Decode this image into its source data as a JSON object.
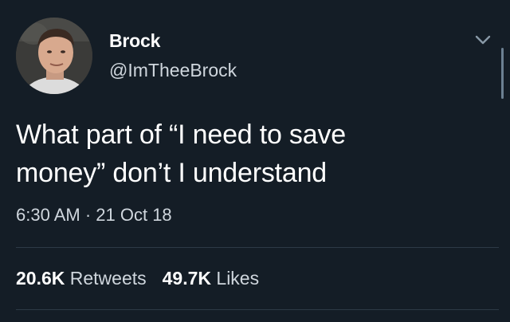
{
  "tweet": {
    "author": {
      "display_name": "Brock",
      "handle": "@ImTheeBrock"
    },
    "text": "What part of “I need to save\nmoney” don’t I understand",
    "timestamp": "6:30 AM · 21 Oct 18",
    "stats": {
      "retweets_count": "20.6K",
      "retweets_label": "Retweets",
      "likes_count": "49.7K",
      "likes_label": "Likes"
    }
  },
  "icons": {
    "caret": "chevron-down-icon"
  },
  "colors": {
    "background": "#141d26",
    "primary_text": "#ffffff",
    "secondary_text": "#cfd6dd",
    "divider": "#2d3a46"
  }
}
